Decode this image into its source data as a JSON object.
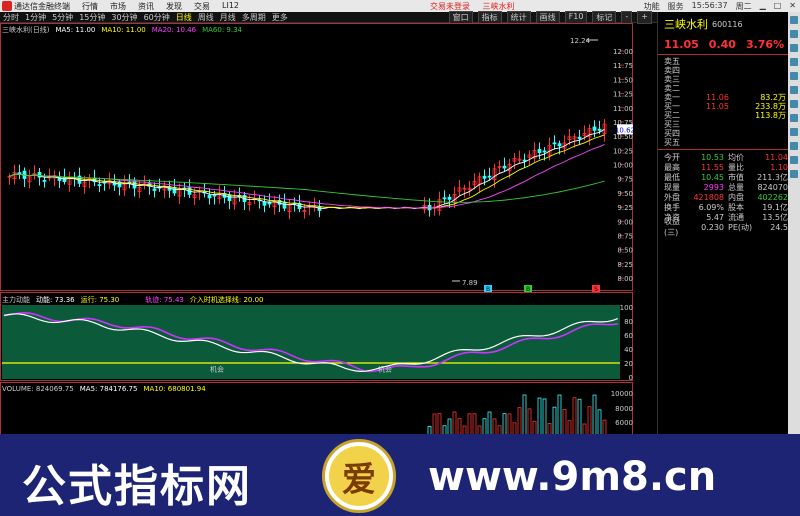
{
  "titlebar": {
    "app_name": "通达信金融终端",
    "menu": [
      "行情",
      "市场",
      "资讯",
      "发现",
      "交易",
      "LI12"
    ],
    "center": [
      "交易未登录",
      "三峡水利"
    ],
    "right": [
      "功能",
      "服务",
      "15:56:37",
      "周二"
    ]
  },
  "toolbar": {
    "tabs": [
      "分时",
      "1分钟",
      "5分钟",
      "15分钟",
      "30分钟",
      "60分钟",
      "日线",
      "周线",
      "月线",
      "多周期",
      "更多"
    ],
    "active_tab": "日线",
    "right_buttons": [
      "窗口",
      "指标",
      "统计",
      "画线",
      "F10",
      "标记",
      "-",
      "+"
    ]
  },
  "main_legend": {
    "title": "三峡水利(日线)",
    "ma5": "MA5: 11.00",
    "ma10": "MA10: 11.00",
    "ma20": "MA20: 10.46",
    "ma60": "MA60: 9.34"
  },
  "price_axis": [
    "12.00",
    "11.75",
    "11.50",
    "11.25",
    "11.00",
    "10.75",
    "10.50",
    "10.25",
    "10.00",
    "9.75",
    "9.50",
    "9.25",
    "9.00",
    "8.75",
    "8.50",
    "8.25",
    "8.00"
  ],
  "price_marker": "10.62",
  "high_label": "12.24",
  "low_label": "7.89",
  "signals": [
    "B",
    "B",
    "S"
  ],
  "indicator_legend": {
    "name": "主力动能",
    "dongneng": "动能: 73.36",
    "yunxing": "运行: 75.30",
    "guiji": "轨迹: 75.43",
    "line": "介入时机选择线: 20.00"
  },
  "indicator_axis": [
    "100",
    "80",
    "60",
    "40",
    "20",
    "0"
  ],
  "chance_labels": [
    "机会",
    "机会"
  ],
  "volume_legend": {
    "vol": "VOLUME: 824069.75",
    "ma5": "MA5: 784176.75",
    "ma10": "MA10: 680801.94"
  },
  "volume_axis": [
    "10000",
    "8000",
    "6000"
  ],
  "quote": {
    "name": "三峡水利",
    "code": "600116",
    "price": "11.05",
    "change": "0.40",
    "pct": "3.76%",
    "order_book": [
      {
        "label": "卖五",
        "price": "",
        "vol": ""
      },
      {
        "label": "卖四",
        "price": "",
        "vol": ""
      },
      {
        "label": "卖三",
        "price": "",
        "vol": ""
      },
      {
        "label": "卖二",
        "price": "",
        "vol": ""
      },
      {
        "label": "卖一",
        "price": "11.06",
        "vol": "83.2万"
      },
      {
        "label": "买一",
        "price": "11.05",
        "vol": "233.8万"
      },
      {
        "label": "买二",
        "price": "",
        "vol": "113.8万"
      },
      {
        "label": "买三",
        "price": "",
        "vol": ""
      },
      {
        "label": "买四",
        "price": "",
        "vol": ""
      },
      {
        "label": "买五",
        "price": "",
        "vol": ""
      }
    ],
    "stats": [
      {
        "a": "今开",
        "b": "10.53",
        "bc": "#3c3",
        "c": "均价",
        "d": "11.04",
        "dc": "#f33"
      },
      {
        "a": "最高",
        "b": "11.55",
        "bc": "#f33",
        "c": "量比",
        "d": "1.10",
        "dc": "#f33"
      },
      {
        "a": "最低",
        "b": "10.45",
        "bc": "#3c3",
        "c": "市值",
        "d": "211.3亿",
        "dc": "#ccc"
      },
      {
        "a": "现量",
        "b": "2993",
        "bc": "#f3f",
        "c": "总量",
        "d": "824070",
        "dc": "#ccc"
      },
      {
        "a": "外盘",
        "b": "421808",
        "bc": "#f33",
        "c": "内盘",
        "d": "402262",
        "dc": "#3c3"
      },
      {
        "a": "换手",
        "b": "6.09%",
        "bc": "#ccc",
        "c": "股本",
        "d": "19.1亿",
        "dc": "#ccc"
      },
      {
        "a": "净资",
        "b": "5.47",
        "bc": "#ccc",
        "c": "流通",
        "d": "13.5亿",
        "dc": "#ccc"
      },
      {
        "a": "收益(三)",
        "b": "0.230",
        "bc": "#ccc",
        "c": "PE(动)",
        "d": "24.5",
        "dc": "#ccc"
      }
    ]
  },
  "banner": {
    "title": "公式指标网",
    "url": "www.9m8.cn",
    "coin_char": "爱"
  },
  "colors": {
    "up": "#ff3333",
    "down": "#33ffff",
    "ma5": "#ffffff",
    "ma10": "#ffff00",
    "ma20": "#ff44ff",
    "ma60": "#33cc33",
    "indicator_bg": "#0b5a3a"
  }
}
